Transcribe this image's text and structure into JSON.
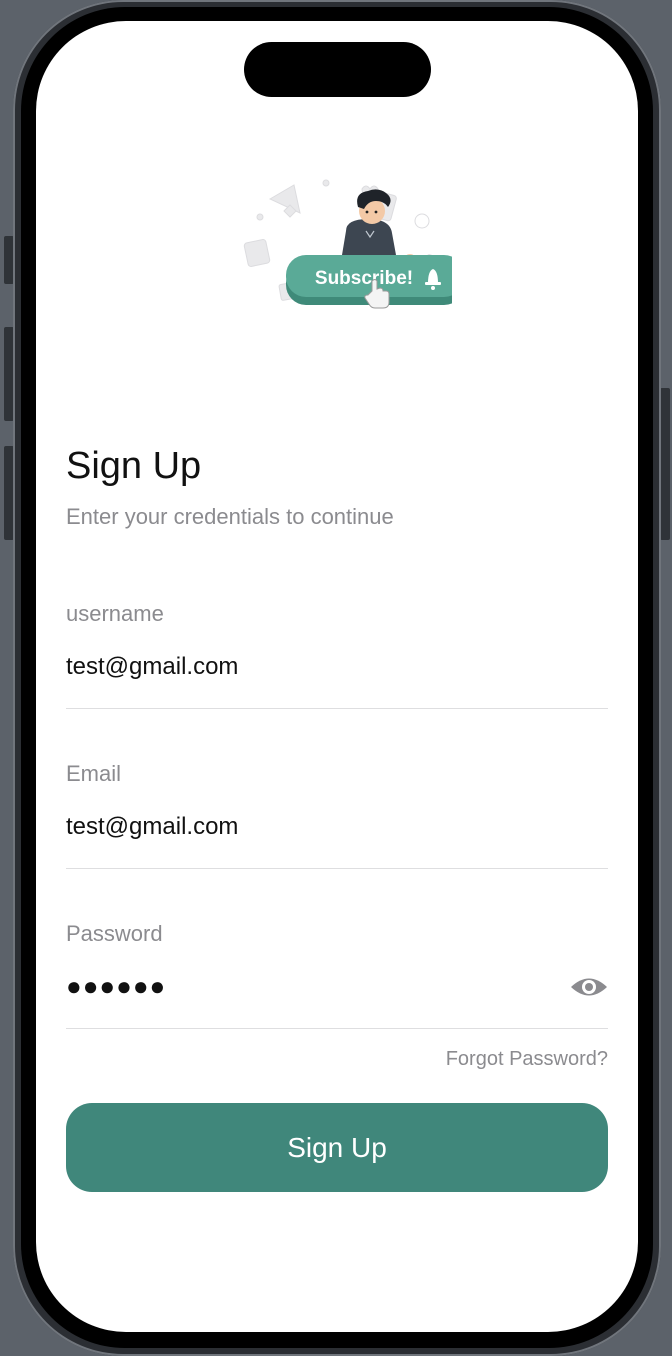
{
  "header": {
    "title": "Sign Up",
    "subtitle": "Enter your credentials to continue"
  },
  "illustration": {
    "name": "subscribe-illustration",
    "badge_text": "Subscribe!"
  },
  "form": {
    "username": {
      "label": "username",
      "value": "test@gmail.com"
    },
    "email": {
      "label": "Email",
      "value": "test@gmail.com"
    },
    "password": {
      "label": "Password",
      "masked_value": "●●●●●●"
    },
    "forgot_label": "Forgot Password?",
    "submit_label": "Sign Up"
  },
  "colors": {
    "primary": "#40877b",
    "muted_text": "#8b8b8f",
    "badge": "#5aaa97"
  },
  "icons": {
    "password_toggle": "eye-icon"
  }
}
